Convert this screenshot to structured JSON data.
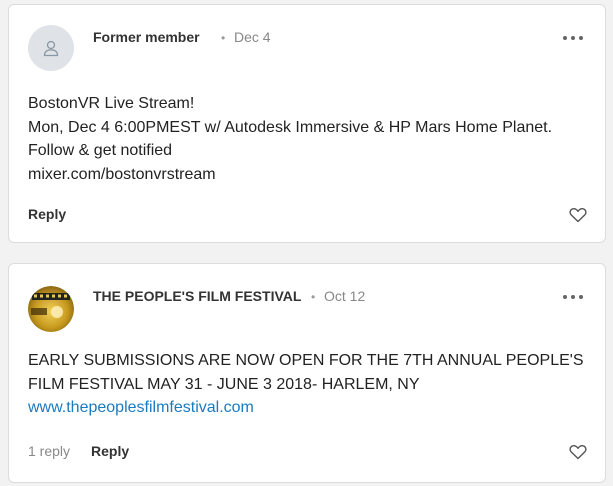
{
  "posts": [
    {
      "author": "Former member",
      "date": "Dec 4",
      "avatar_icon": "person-placeholder-icon",
      "lines": [
        "BostonVR Live Stream!",
        "Mon, Dec 4 6:00PMEST w/ Autodesk Immersive & HP Mars Home Planet.",
        "Follow & get notified",
        "mixer.com/bostonvrstream"
      ],
      "reply_label": "Reply"
    },
    {
      "author": "THE PEOPLE'S FILM FESTIVAL",
      "date": "Oct 12",
      "lines": [
        "EARLY SUBMISSIONS ARE NOW OPEN FOR THE 7TH ANNUAL PEOPLE'S",
        "FILM FESTIVAL MAY 31 - JUNE 3 2018- HARLEM, NY"
      ],
      "link": "www.thepeoplesfilmfestival.com",
      "reply_count": "1 reply",
      "reply_label": "Reply"
    }
  ],
  "separator": "•",
  "colors": {
    "link": "#1a7bbf",
    "page_bg": "#f2f2f2",
    "card_border": "#dcdcdc"
  }
}
